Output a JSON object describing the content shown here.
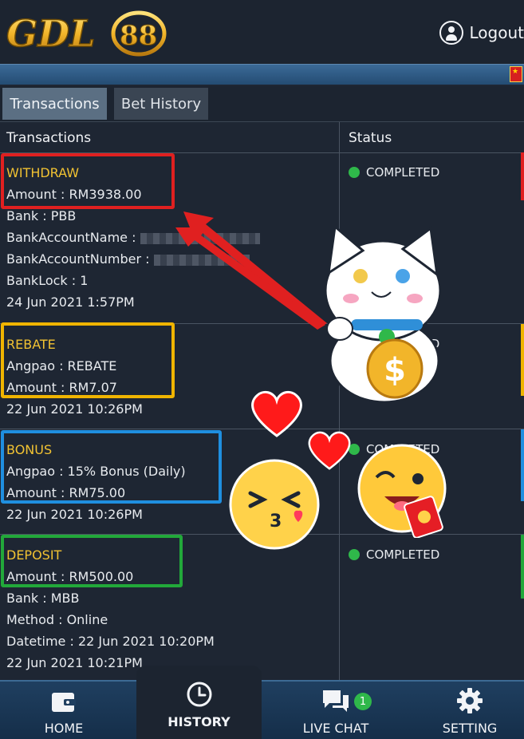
{
  "brand": {
    "logo_text": "GDL88"
  },
  "header": {
    "logout_label": "Logout"
  },
  "tabs": [
    {
      "label": "Transactions",
      "active": true
    },
    {
      "label": "Bet History",
      "active": false
    }
  ],
  "table": {
    "headers": {
      "transactions": "Transactions",
      "status": "Status"
    },
    "rows": [
      {
        "type": "WITHDRAW",
        "lines": [
          "Amount : RM3938.00",
          "Bank : PBB",
          "BankAccountName :",
          "BankAccountNumber :",
          "BankLock : 1",
          "24 Jun 2021 1:57PM"
        ],
        "status": "COMPLETED"
      },
      {
        "type": "REBATE",
        "lines": [
          "Angpao : REBATE",
          "Amount : RM7.07",
          "22 Jun 2021 10:26PM"
        ],
        "status": "COMPLETED"
      },
      {
        "type": "BONUS",
        "lines": [
          "Angpao : 15% Bonus (Daily)",
          "Amount : RM75.00",
          "22 Jun 2021 10:26PM"
        ],
        "status": "COMPLETED"
      },
      {
        "type": "DEPOSIT",
        "lines": [
          "Amount : RM500.00",
          "Bank : MBB",
          "Method : Online",
          "Datetime : 22 Jun 2021 10:20PM",
          "22 Jun 2021 10:21PM"
        ],
        "status": "COMPLETED"
      }
    ]
  },
  "nav": {
    "home": "HOME",
    "history": "HISTORY",
    "live_chat": "LIVE CHAT",
    "live_chat_badge": "1",
    "setting": "SETTING"
  },
  "colors": {
    "accent_gold": "#f1c232",
    "status_green": "#2fb84a",
    "withdraw_box": "#e02020",
    "rebate_box": "#f0b400",
    "bonus_box": "#1f8fe0",
    "deposit_box": "#22a83a"
  },
  "icons": [
    "user-icon",
    "flag-icon",
    "wallet-icon",
    "clock-icon",
    "chat-icon",
    "gear-icon"
  ]
}
